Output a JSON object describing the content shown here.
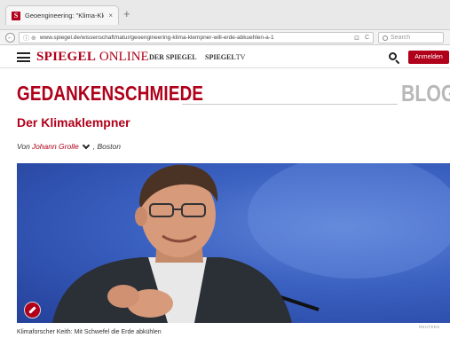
{
  "browser": {
    "tab_favicon": "S",
    "tab_title": "Geoengineering: \"Klima-Kle",
    "tab_close": "×",
    "new_tab": "+",
    "back": "←",
    "url_info": "ⓘ ⊕",
    "url": "www.spiegel.de/wissenschaft/natur/geoengineering-klima-klempner-will-erde-abkuehlen-a-1",
    "url_reader": "⊡",
    "url_reload": "C",
    "search_placeholder": "Search"
  },
  "site_header": {
    "brand_spiegel": "SPIEGEL",
    "brand_online": "ONLINE",
    "der_spiegel": "DER SPIEGEL",
    "spiegel_tv_a": "SPIEGEL",
    "spiegel_tv_b": "TV",
    "login_label": "Anmelden"
  },
  "article": {
    "blog_title": "GEDANKENSCHMIEDE",
    "blog_label": "BLOG",
    "headline": "Der Klimaklempner",
    "byline_prefix": "Von",
    "byline_author": "Johann Grolle",
    "byline_location": ", Boston",
    "photo_credit": "REUTERS",
    "caption": "Klimaforscher Keith: Mit Schwefel die Erde abkühlen"
  },
  "colors": {
    "brand_red": "#b0001a",
    "hero_blue": "#3a60c0"
  },
  "icons": {
    "menu": "hamburger-icon",
    "search": "search-icon",
    "photo": "pen-icon"
  }
}
